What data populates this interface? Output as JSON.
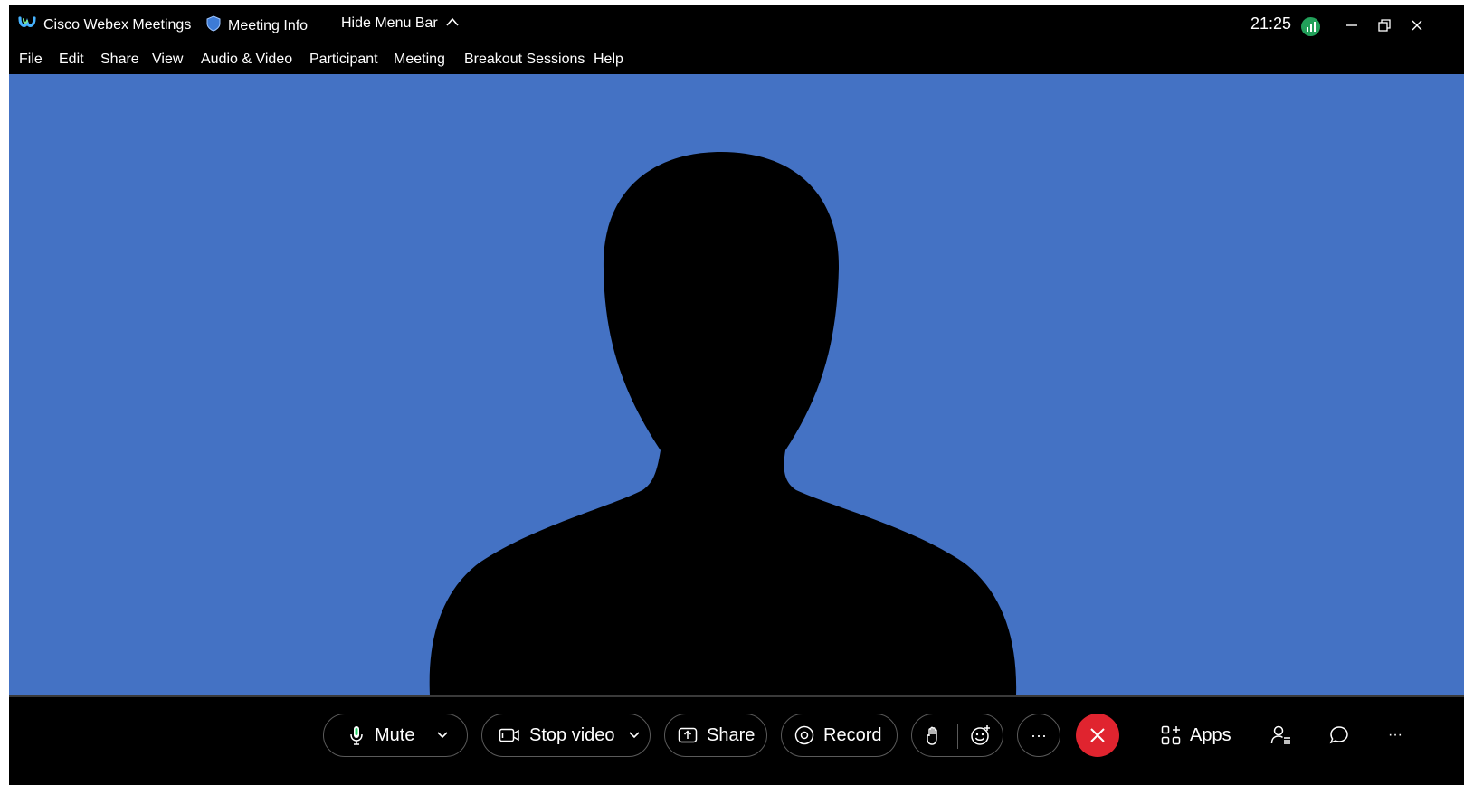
{
  "titlebar": {
    "app_name": "Cisco Webex Meetings",
    "meeting_info": "Meeting Info",
    "hide_menu_bar": "Hide Menu Bar",
    "time": "21:25"
  },
  "menu": {
    "file": "File",
    "edit": "Edit",
    "share": "Share",
    "view": "View",
    "audio_video": "Audio & Video",
    "participant": "Participant",
    "meeting": "Meeting",
    "breakout": "Breakout Sessions",
    "help": "Help"
  },
  "controls": {
    "mute": "Mute",
    "stop_video": "Stop video",
    "share": "Share",
    "record": "Record",
    "more": "···",
    "apps": "Apps",
    "overflow": "···"
  },
  "colors": {
    "video_background": "#4472c4",
    "end_button": "#e0242f",
    "status_green": "#22a05a"
  }
}
